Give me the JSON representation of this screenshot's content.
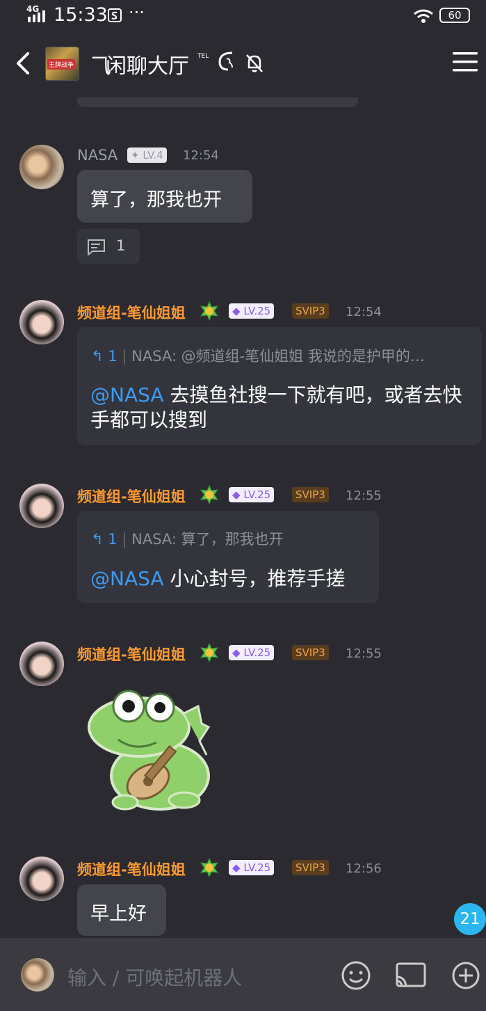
{
  "status_bar": {
    "network": "4G",
    "time": "15:33",
    "battery": "60"
  },
  "header": {
    "title": "闲聊大厅",
    "superscript": "TEL"
  },
  "messages": [
    {
      "sender": "NASA",
      "level": "LV.4",
      "time": "12:54",
      "text": "算了，那我也开",
      "thread_count": "1"
    },
    {
      "sender": "频道组-笔仙姐姐",
      "level": "LV.25",
      "vip": "SVIP3",
      "time": "12:54",
      "reply_count": "1",
      "reply_quote": "NASA: @频道组-笔仙姐姐 我说的是护甲的…",
      "mention": "@NASA",
      "text": " 去摸鱼社搜一下就有吧，或者去快手都可以搜到"
    },
    {
      "sender": "频道组-笔仙姐姐",
      "level": "LV.25",
      "vip": "SVIP3",
      "time": "12:55",
      "reply_count": "1",
      "reply_quote": "NASA: 算了，那我也开",
      "mention": "@NASA",
      "text": " 小心封号，推荐手搓"
    },
    {
      "sender": "频道组-笔仙姐姐",
      "level": "LV.25",
      "vip": "SVIP3",
      "time": "12:55",
      "sticker": "frog-guitar-sticker"
    },
    {
      "sender": "频道组-笔仙姐姐",
      "level": "LV.25",
      "vip": "SVIP3",
      "time": "12:56",
      "text": "早上好"
    }
  ],
  "unread_count": "21",
  "input": {
    "placeholder": "输入 / 可唤起机器人"
  },
  "colors": {
    "background": "#2b2a31",
    "mention": "#3a9cf6",
    "admin_name": "#ff9a2e",
    "unread": "#2bb6f0"
  }
}
